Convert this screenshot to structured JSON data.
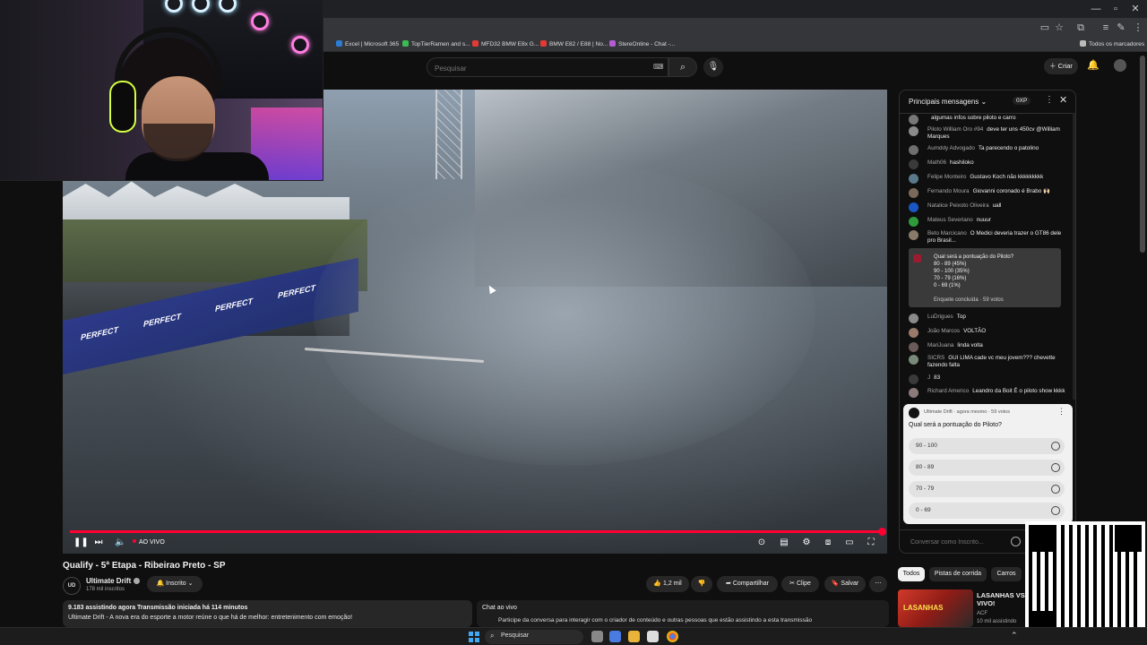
{
  "browser": {
    "bookmarks": [
      {
        "label": "Excel | Microsoft 365",
        "color": "#2b7cd3"
      },
      {
        "label": "TopTierRamen and s...",
        "color": "#3cba54"
      },
      {
        "label": "MFD32 BMW E8x G...",
        "color": "#e53935"
      },
      {
        "label": "BMW E82 / E88 | No...",
        "color": "#e53935"
      },
      {
        "label": "StereOnline - Chat -...",
        "color": "#b45bd6"
      }
    ],
    "all_bookmarks": "Todos os marcadores"
  },
  "header": {
    "search_placeholder": "Pesquisar",
    "create_label": "Criar"
  },
  "player": {
    "live_label": "AO VIVO",
    "barrier_text": "PERFECT"
  },
  "video": {
    "title": "Qualify - 5ª Etapa - Ribeirao Preto - SP",
    "channel": "Ultimate Drift",
    "subscribers": "178 mil inscritos",
    "subscribe_label": "Inscrito",
    "likes": "1,2 mil",
    "share_label": "Compartilhar",
    "clip_label": "Clipe",
    "save_label": "Salvar",
    "description_stats": "9.183 assistindo agora  Transmissão iniciada há 114 minutos",
    "description": "Ultimate Drift - A nova era do esporte a motor reúne o que há de melhor: entretenimento com emoção!",
    "live_chat_box_title": "Chat ao vivo",
    "live_chat_box_text": "Participe da conversa para interagir com o criador de conteúdo e outras pessoas que estão assistindo a esta transmissão"
  },
  "chat": {
    "title": "Principais mensagens",
    "xp": "0XP",
    "messages_top": [
      {
        "author": "",
        "text": "algumas infos sobre piloto e carro",
        "color": "#777"
      },
      {
        "author": "Piloto William Oro #94",
        "text": "deve ter uns 450cv @William Marques",
        "color": "#8a8a8a"
      },
      {
        "author": "Aumddy Advogado",
        "text": "Ta parecendo o patolino",
        "color": "#6f6f6f"
      },
      {
        "author": "Math06",
        "text": "hashiloko",
        "color": "#3a3a3a"
      },
      {
        "author": "Felipe Monteiro",
        "text": "Gustavo Koch não kkkkkkkkk",
        "color": "#5a7a8a"
      },
      {
        "author": "Fernando Moura",
        "text": "Giovanni coronado é Brabo 🙌🏻",
        "color": "#7a6a5a"
      },
      {
        "author": "Natalice Peixoto Oliveira",
        "text": "uall",
        "color": "#1a56c4"
      },
      {
        "author": "Mateus Severiano",
        "text": "nuuur",
        "color": "#2e9a3c"
      },
      {
        "author": "Beto Marcicano",
        "text": "O Medici deveria trazer o GT86 dele pro Brasil...",
        "color": "#8a7a6a"
      }
    ],
    "poll_result": [
      "Qual será a pontuação do Piloto?",
      "80 - 89 (45%)",
      "90 - 100 (35%)",
      "70 - 79 (16%)",
      "0 - 69 (1%)",
      "Enquete concluída · 59 votos"
    ],
    "messages_bottom": [
      {
        "author": "LuDrigues",
        "text": "Top",
        "color": "#8a8a8a"
      },
      {
        "author": "João Marcos",
        "text": "VOLTÃO",
        "color": "#9a7a6a"
      },
      {
        "author": "MariJuana",
        "text": "linda volta",
        "color": "#6a5a5a"
      },
      {
        "author": "SICRS",
        "text": "GUI LIMA cade vc meu jovem??? chevette fazendo falta",
        "color": "#7a8a7a"
      },
      {
        "author": "J",
        "text": "83",
        "color": "#3a3a3a"
      },
      {
        "author": "Richard Americo",
        "text": "Leandro da Boit É o piloto show kkkk",
        "color": "#8a7a7a"
      }
    ],
    "poll": {
      "meta": "Ultimate Drift · agora mesmo · 59 votos",
      "question": "Qual será a pontuação do Piloto?",
      "options": [
        "90 - 100",
        "80 - 89",
        "70 - 79",
        "0 - 69"
      ]
    },
    "input_placeholder": "Conversar como Inscrito..."
  },
  "related": {
    "chips": [
      "Todos",
      "Pistas de corrida",
      "Carros"
    ],
    "title_line1": "LASANHAS VS S",
    "title_line2": "VIVO!",
    "thumb_text": "LASANHAS",
    "channel": "ACF",
    "meta": "10 mil assistindo"
  },
  "taskbar": {
    "search_label": "Pesquisar"
  }
}
